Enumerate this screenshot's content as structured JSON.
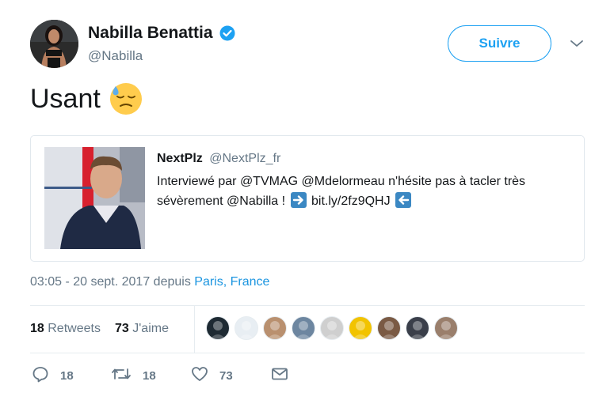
{
  "author": {
    "name": "Nabilla Benattia",
    "handle": "@Nabilla",
    "verified": true
  },
  "follow_button": {
    "label": "Suivre"
  },
  "tweet": {
    "text": "Usant",
    "emoji": "downcast-face-with-sweat"
  },
  "quoted_tweet": {
    "name": "NextPlz",
    "handle": "@NextPlz_fr",
    "text_line1": "Interviewé par @TVMAG @Mdelormeau n'hésite pas à tacler très",
    "text_line2_start": "sévèrement @Nabilla !",
    "link": "bit.ly/2fz9QHJ"
  },
  "meta": {
    "time": "03:05 - 20 sept. 2017 depuis ",
    "place": "Paris, France"
  },
  "stats": {
    "retweets_count": "18",
    "retweets_label": "Retweets",
    "likes_count": "73",
    "likes_label": "J'aime"
  },
  "likers": [
    "#1e2a33",
    "#e8eef3",
    "#b9906f",
    "#6d86a0",
    "#cfcfcf",
    "#f2c300",
    "#7a5a44",
    "#3a3f4a",
    "#9a7f6c"
  ],
  "actions": {
    "reply_count": "18",
    "retweet_count": "18",
    "like_count": "73"
  },
  "colors": {
    "accent": "#1da1f2",
    "link": "#1b95e0",
    "muted": "#657786",
    "border": "#e1e8ed"
  }
}
